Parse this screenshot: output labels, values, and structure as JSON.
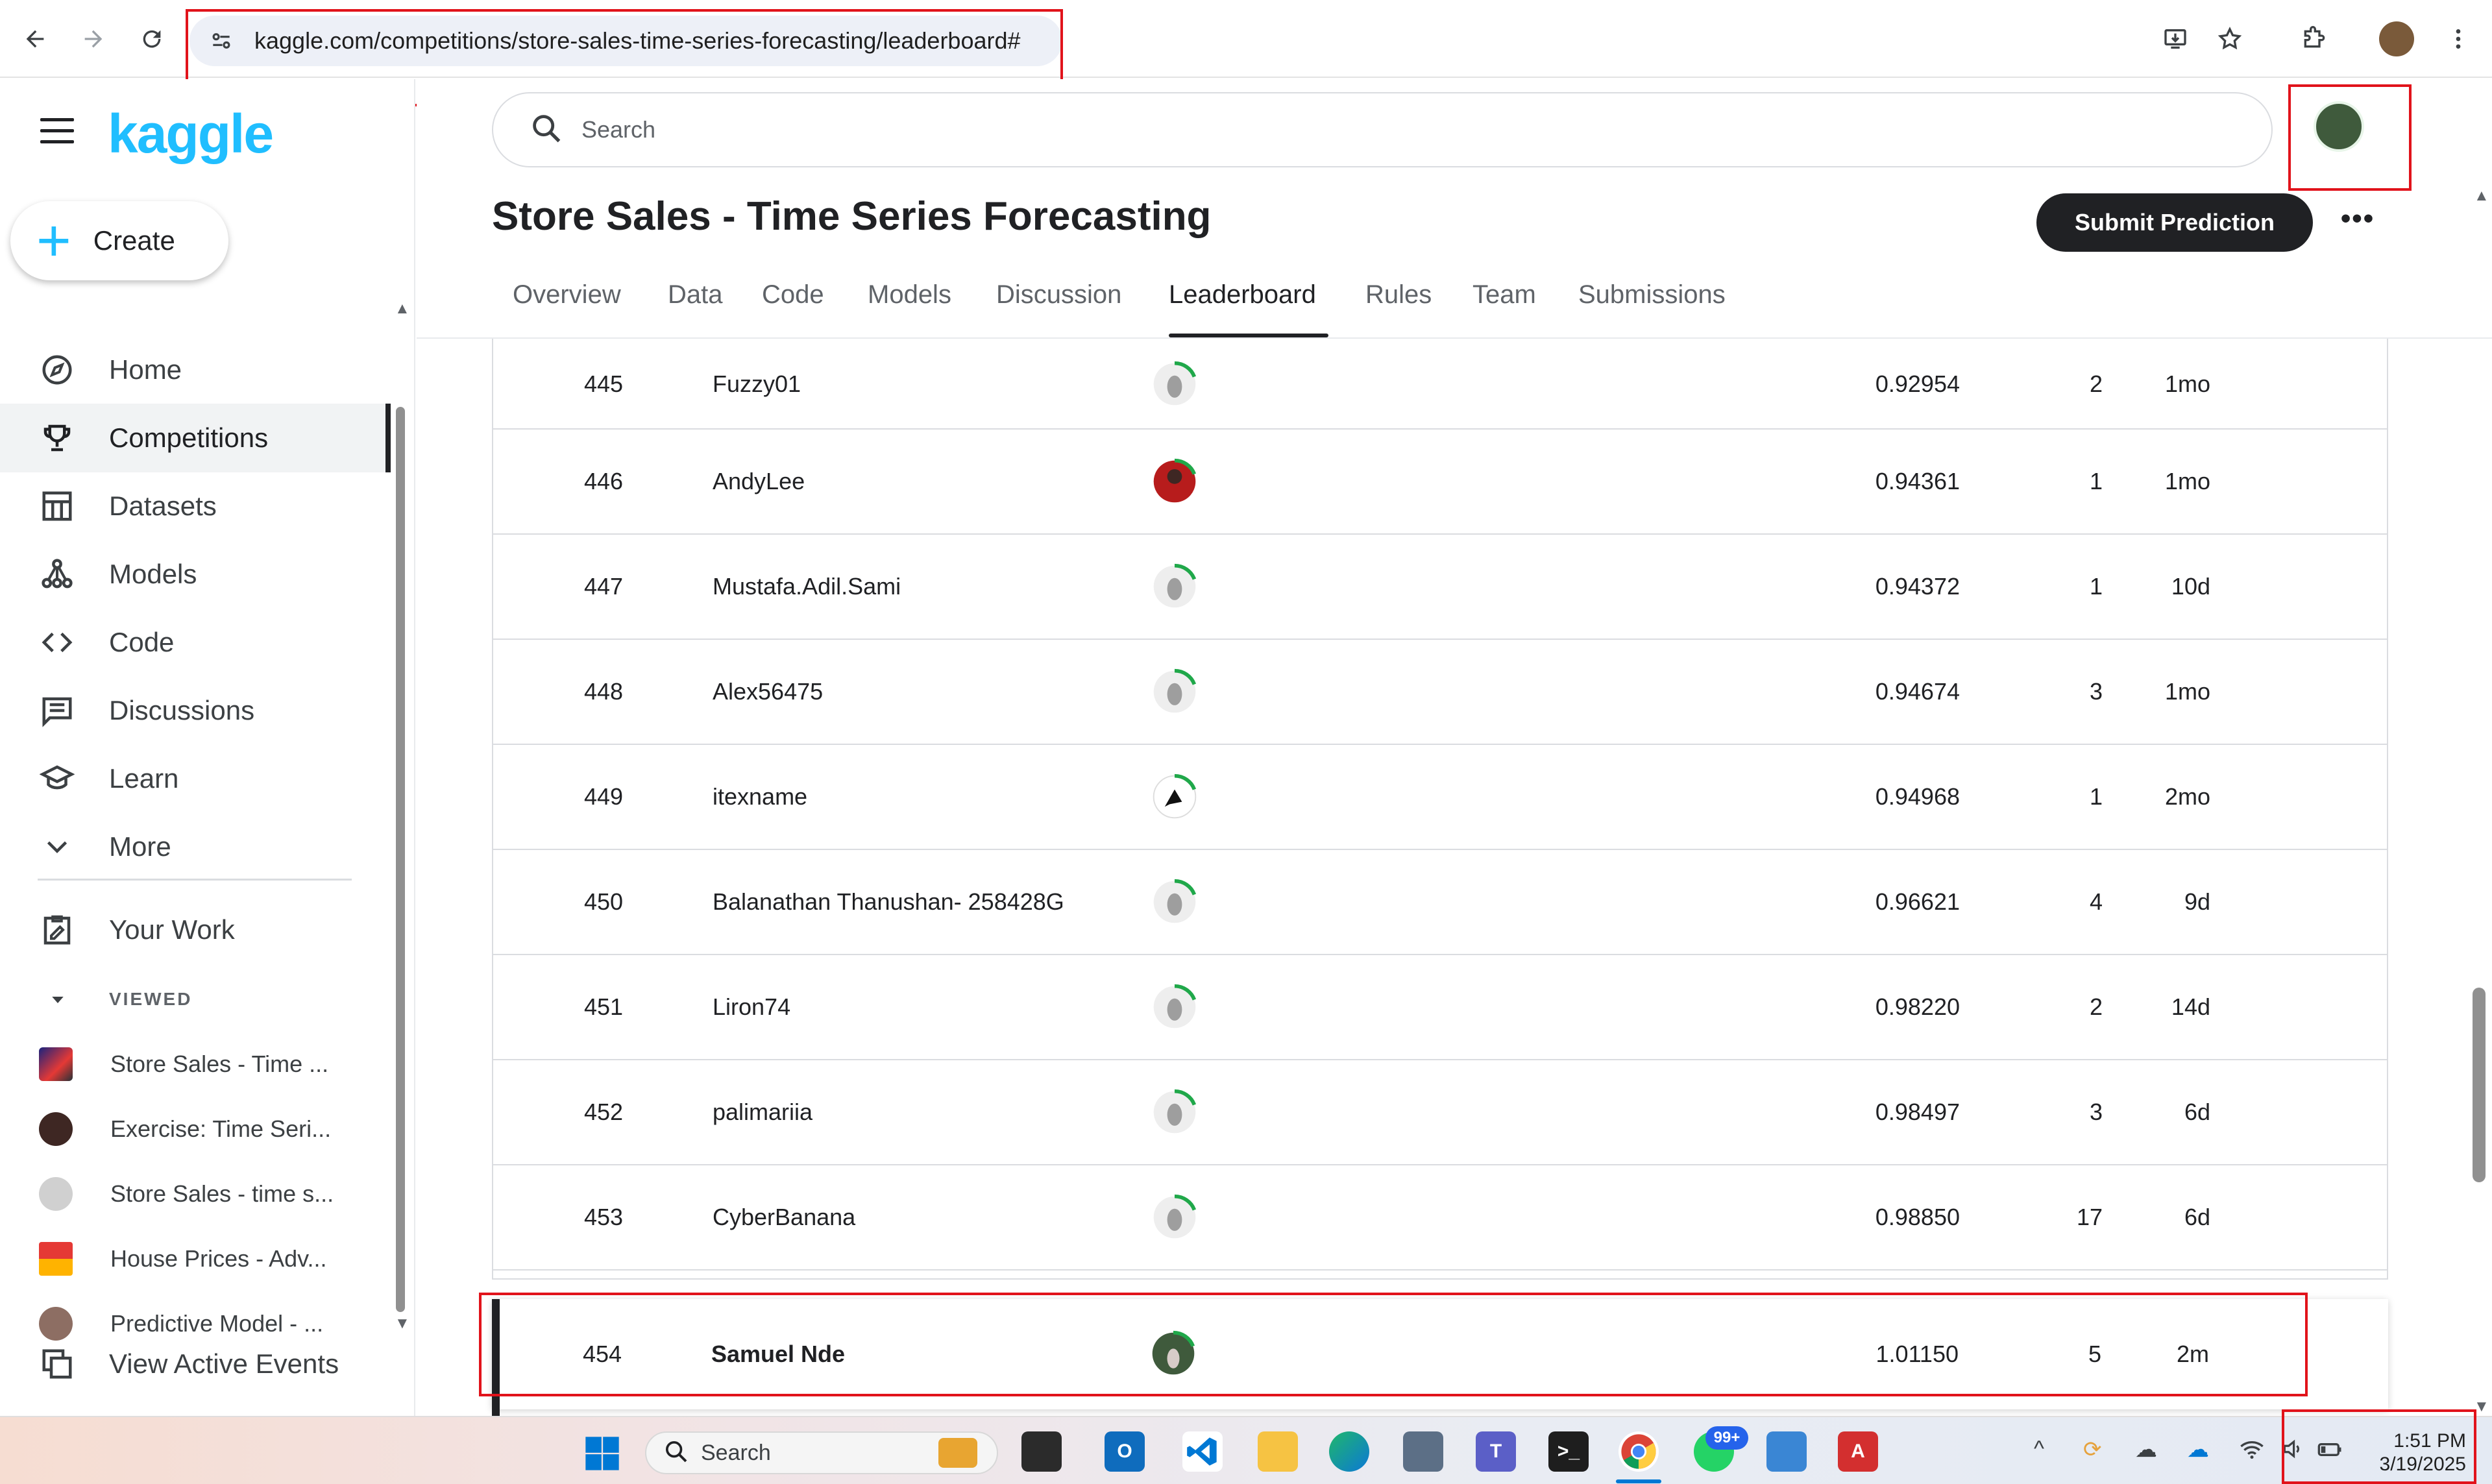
{
  "browser": {
    "url": "kaggle.com/competitions/store-sales-time-series-forecasting/leaderboard#",
    "icons": [
      "back-icon",
      "forward-icon",
      "reload-icon",
      "site-info-icon",
      "install-icon",
      "bookmark-star-icon",
      "extensions-icon",
      "profile-icon",
      "menu-icon"
    ]
  },
  "sidebar": {
    "logo": "kaggle",
    "create_label": "Create",
    "nav": [
      {
        "label": "Home",
        "icon": "compass-icon"
      },
      {
        "label": "Competitions",
        "icon": "trophy-icon",
        "active": true
      },
      {
        "label": "Datasets",
        "icon": "table-icon"
      },
      {
        "label": "Models",
        "icon": "models-icon"
      },
      {
        "label": "Code",
        "icon": "code-icon"
      },
      {
        "label": "Discussions",
        "icon": "comments-icon"
      },
      {
        "label": "Learn",
        "icon": "school-icon"
      },
      {
        "label": "More",
        "icon": "chevron-down-icon"
      }
    ],
    "your_work": "Your Work",
    "viewed_label": "VIEWED",
    "viewed": [
      {
        "label": "Store Sales - Time ..."
      },
      {
        "label": "Exercise: Time Seri..."
      },
      {
        "label": "Store Sales - time s..."
      },
      {
        "label": "House Prices - Adv..."
      },
      {
        "label": "Predictive Model - ..."
      }
    ],
    "active_events": "View Active Events"
  },
  "header": {
    "search_placeholder": "Search",
    "title": "Store Sales - Time Series Forecasting",
    "submit_label": "Submit Prediction",
    "more_label": "•••",
    "tabs": [
      {
        "label": "Overview"
      },
      {
        "label": "Data"
      },
      {
        "label": "Code"
      },
      {
        "label": "Models"
      },
      {
        "label": "Discussion"
      },
      {
        "label": "Leaderboard",
        "active": true
      },
      {
        "label": "Rules"
      },
      {
        "label": "Team"
      },
      {
        "label": "Submissions"
      }
    ]
  },
  "leaderboard": {
    "rows": [
      {
        "rank": "445",
        "team": "Fuzzy01",
        "score": "0.92954",
        "entries": "2",
        "last": "1mo"
      },
      {
        "rank": "446",
        "team": "AndyLee",
        "score": "0.94361",
        "entries": "1",
        "last": "1mo"
      },
      {
        "rank": "447",
        "team": "Mustafa.Adil.Sami",
        "score": "0.94372",
        "entries": "1",
        "last": "10d"
      },
      {
        "rank": "448",
        "team": "Alex56475",
        "score": "0.94674",
        "entries": "3",
        "last": "1mo"
      },
      {
        "rank": "449",
        "team": "itexname",
        "score": "0.94968",
        "entries": "1",
        "last": "2mo"
      },
      {
        "rank": "450",
        "team": "Balanathan Thanushan- 258428G",
        "score": "0.96621",
        "entries": "4",
        "last": "9d"
      },
      {
        "rank": "451",
        "team": "Liron74",
        "score": "0.98220",
        "entries": "2",
        "last": "14d"
      },
      {
        "rank": "452",
        "team": "palimariia",
        "score": "0.98497",
        "entries": "3",
        "last": "6d"
      },
      {
        "rank": "453",
        "team": "CyberBanana",
        "score": "0.98850",
        "entries": "17",
        "last": "6d"
      }
    ],
    "my_row": {
      "rank": "454",
      "team": "Samuel Nde",
      "score": "1.01150",
      "entries": "5",
      "last": "2m"
    }
  },
  "taskbar": {
    "search_label": "Search",
    "badge": "99+",
    "time": "1:51 PM",
    "date": "3/19/2025"
  }
}
